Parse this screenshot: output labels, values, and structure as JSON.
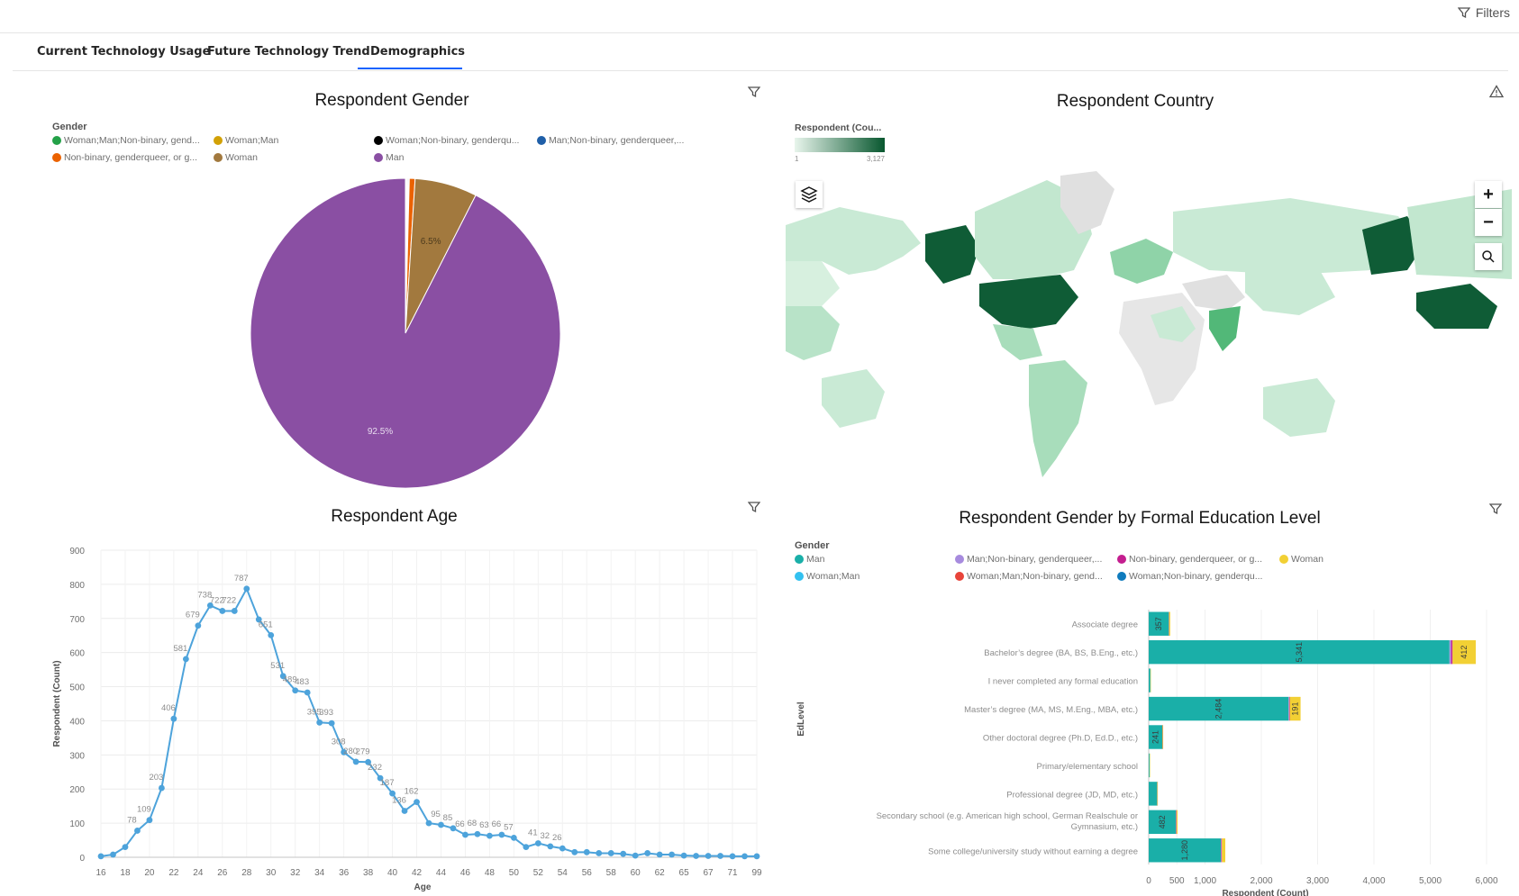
{
  "header": {
    "filters_label": "Filters"
  },
  "tabs": [
    {
      "label": "Current Technology Usage",
      "active": false
    },
    {
      "label": "Future Technology Trend",
      "active": false
    },
    {
      "label": "Demographics",
      "active": true
    }
  ],
  "gender_panel": {
    "title": "Respondent Gender",
    "legend_title": "Gender",
    "legend": [
      {
        "label": "Woman;Man;Non-binary, gend...",
        "color": "#24a148"
      },
      {
        "label": "Woman;Man",
        "color": "#d2a106"
      },
      {
        "label": "Woman;Non-binary, genderqu...",
        "color": "#000000"
      },
      {
        "label": "Man;Non-binary, genderqueer,...",
        "color": "#1f5fa8"
      },
      {
        "label": "Non-binary, genderqueer, or g...",
        "color": "#eb6200"
      },
      {
        "label": "Woman",
        "color": "#a2793e"
      },
      {
        "label": "Man",
        "color": "#8a4fa3"
      }
    ]
  },
  "country_panel": {
    "title": "Respondent Country",
    "legend_title": "Respondent (Cou...",
    "scale_min": "1",
    "scale_max": "3,127",
    "zoom_in": "+",
    "zoom_out": "−"
  },
  "age_panel": {
    "title": "Respondent Age"
  },
  "edu_panel": {
    "title": "Respondent Gender by Formal Education Level",
    "legend_title": "Gender",
    "legend": [
      {
        "label": "Man",
        "color": "#1aafa8"
      },
      {
        "label": "Man;Non-binary, genderqueer,...",
        "color": "#a78bde"
      },
      {
        "label": "Non-binary, genderqueer, or g...",
        "color": "#c41e8f"
      },
      {
        "label": "Woman",
        "color": "#f2d034"
      },
      {
        "label": "Woman;Man",
        "color": "#33c1f0"
      },
      {
        "label": "Woman;Man;Non-binary, gend...",
        "color": "#e8443a"
      },
      {
        "label": "Woman;Non-binary, genderqu...",
        "color": "#0f7bbd"
      }
    ]
  },
  "chart_data": [
    {
      "type": "pie",
      "title": "Respondent Gender",
      "slices": [
        {
          "label": "Woman;Man;Non-binary, gend...",
          "value": 0.1,
          "color": "#24a148"
        },
        {
          "label": "Woman;Man",
          "value": 0.1,
          "color": "#d2a106"
        },
        {
          "label": "Woman;Non-binary, genderqu...",
          "value": 0.1,
          "color": "#000000"
        },
        {
          "label": "Man;Non-binary, genderqueer,...",
          "value": 0.1,
          "color": "#1f5fa8"
        },
        {
          "label": "Non-binary, genderqueer, or g...",
          "value": 0.6,
          "color": "#eb6200"
        },
        {
          "label": "Woman",
          "value": 6.5,
          "color": "#a2793e"
        },
        {
          "label": "Man",
          "value": 92.5,
          "color": "#8a4fa3"
        }
      ],
      "data_labels": [
        "6.5%",
        "92.5%"
      ]
    },
    {
      "type": "line",
      "title": "Respondent Age",
      "xlabel": "Age",
      "ylabel": "Respondent (Count)",
      "ylim": [
        0,
        900
      ],
      "yticks": [
        0,
        100,
        200,
        300,
        400,
        500,
        600,
        700,
        800,
        900
      ],
      "xticks": [
        "16",
        "18",
        "20",
        "22",
        "24",
        "26",
        "28",
        "30",
        "32",
        "34",
        "36",
        "38",
        "40",
        "42",
        "44",
        "46",
        "48",
        "50",
        "52",
        "54",
        "56",
        "58",
        "60",
        "62",
        "65",
        "67",
        "71",
        "99"
      ],
      "values": [
        3,
        8,
        30,
        78,
        109,
        203,
        406,
        581,
        679,
        738,
        722,
        722,
        787,
        697,
        651,
        531,
        489,
        483,
        395,
        393,
        308,
        280,
        279,
        232,
        187,
        136,
        162,
        100,
        95,
        85,
        66,
        68,
        63,
        66,
        57,
        30,
        41,
        32,
        26,
        15,
        15,
        12,
        12,
        10,
        5,
        12,
        8,
        8,
        5,
        4,
        4,
        4,
        3,
        3,
        3
      ],
      "labels": [
        {
          "i": 4,
          "text": "109"
        },
        {
          "i": 3,
          "text": "78"
        },
        {
          "i": 5,
          "text": "203"
        },
        {
          "i": 6,
          "text": "406"
        },
        {
          "i": 7,
          "text": "581"
        },
        {
          "i": 8,
          "text": "679"
        },
        {
          "i": 9,
          "text": "738"
        },
        {
          "i": 10,
          "text": "722"
        },
        {
          "i": 11,
          "text": "722"
        },
        {
          "i": 12,
          "text": "787"
        },
        {
          "i": 14,
          "text": "651"
        },
        {
          "i": 15,
          "text": "531"
        },
        {
          "i": 16,
          "text": "489"
        },
        {
          "i": 17,
          "text": "483"
        },
        {
          "i": 18,
          "text": "395"
        },
        {
          "i": 19,
          "text": "393"
        },
        {
          "i": 20,
          "text": "308"
        },
        {
          "i": 21,
          "text": "280"
        },
        {
          "i": 22,
          "text": "279"
        },
        {
          "i": 23,
          "text": "232"
        },
        {
          "i": 24,
          "text": "187"
        },
        {
          "i": 25,
          "text": "136"
        },
        {
          "i": 26,
          "text": "162"
        },
        {
          "i": 28,
          "text": "95"
        },
        {
          "i": 29,
          "text": "85"
        },
        {
          "i": 30,
          "text": "66"
        },
        {
          "i": 31,
          "text": "68"
        },
        {
          "i": 32,
          "text": "63"
        },
        {
          "i": 33,
          "text": "66"
        },
        {
          "i": 34,
          "text": "57"
        },
        {
          "i": 36,
          "text": "41"
        },
        {
          "i": 37,
          "text": "32"
        },
        {
          "i": 38,
          "text": "26"
        }
      ]
    },
    {
      "type": "bar",
      "orientation": "horizontal",
      "stacked": true,
      "title": "Respondent Gender by Formal Education Level",
      "xlabel": "Respondent (Count)",
      "ylabel": "EdLevel",
      "xlim": [
        0,
        6000
      ],
      "xticks": [
        "0",
        "500",
        "1,000",
        "2,000",
        "3,000",
        "4,000",
        "5,000",
        "6,000"
      ],
      "xtick_values": [
        0,
        500,
        1000,
        2000,
        3000,
        4000,
        5000,
        6000
      ],
      "categories": [
        "Associate degree",
        "Bachelor’s degree (BA, BS, B.Eng., etc.)",
        "I never completed any formal education",
        "Master’s degree (MA, MS, M.Eng., MBA, etc.)",
        "Other doctoral degree (Ph.D, Ed.D., etc.)",
        "Primary/elementary school",
        "Professional degree (JD, MD, etc.)",
        "Secondary school (e.g. American high school, German Realschule or Gymnasium, etc.)",
        "Some college/university study without earning a degree"
      ],
      "series": [
        {
          "name": "Man",
          "color": "#1aafa8",
          "values": [
            357,
            5341,
            30,
            2484,
            241,
            15,
            150,
            482,
            1280
          ]
        },
        {
          "name": "Man;Non-binary, genderqueer,...",
          "color": "#a78bde",
          "values": [
            2,
            30,
            0,
            10,
            2,
            0,
            1,
            5,
            10
          ]
        },
        {
          "name": "Non-binary, genderqueer, or g...",
          "color": "#c41e8f",
          "values": [
            3,
            25,
            0,
            12,
            2,
            0,
            1,
            6,
            10
          ]
        },
        {
          "name": "Woman",
          "color": "#f2d034",
          "values": [
            20,
            412,
            3,
            191,
            12,
            2,
            10,
            20,
            60
          ]
        }
      ],
      "data_labels": [
        "357",
        "5,341",
        "412",
        "2,484",
        "191",
        "241",
        "482",
        "1,280"
      ]
    }
  ]
}
